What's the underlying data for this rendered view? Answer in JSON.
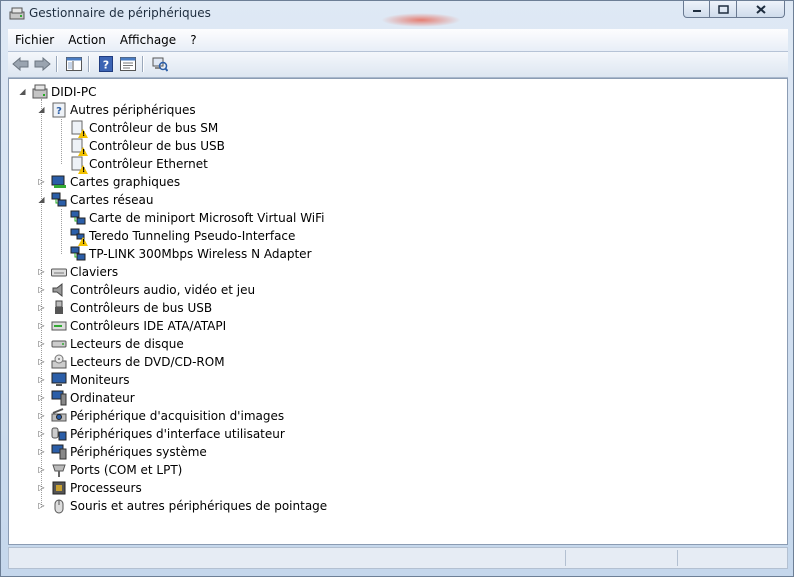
{
  "window": {
    "title": "Gestionnaire de périphériques"
  },
  "menu": [
    "Fichier",
    "Action",
    "Affichage",
    "?"
  ],
  "toolbar": {
    "buttons": [
      "back-icon",
      "forward-icon",
      "show-hide-console-tree-icon",
      "help-icon",
      "properties-icon",
      "scan-hardware-icon"
    ]
  },
  "tree": {
    "root": "DIDI-PC",
    "categories": [
      {
        "label": "Autres périphériques",
        "expanded": true,
        "icon": "unknown-device-icon",
        "children": [
          "Contrôleur de bus SM",
          "Contrôleur de bus USB",
          "Contrôleur Ethernet"
        ]
      },
      {
        "label": "Cartes graphiques",
        "expanded": false,
        "icon": "display-adapter-icon"
      },
      {
        "label": "Cartes réseau",
        "expanded": true,
        "icon": "network-adapter-icon",
        "children": [
          "Carte de miniport Microsoft Virtual WiFi",
          "Teredo Tunneling Pseudo-Interface",
          "TP-LINK 300Mbps Wireless N Adapter"
        ]
      },
      {
        "label": "Claviers",
        "expanded": false,
        "icon": "keyboard-icon"
      },
      {
        "label": "Contrôleurs audio, vidéo et jeu",
        "expanded": false,
        "icon": "speaker-icon"
      },
      {
        "label": "Contrôleurs de bus USB",
        "expanded": false,
        "icon": "usb-icon"
      },
      {
        "label": "Contrôleurs IDE ATA/ATAPI",
        "expanded": false,
        "icon": "ide-controller-icon"
      },
      {
        "label": "Lecteurs de disque",
        "expanded": false,
        "icon": "disk-drive-icon"
      },
      {
        "label": "Lecteurs de DVD/CD-ROM",
        "expanded": false,
        "icon": "dvd-drive-icon"
      },
      {
        "label": "Moniteurs",
        "expanded": false,
        "icon": "monitor-icon"
      },
      {
        "label": "Ordinateur",
        "expanded": false,
        "icon": "computer-icon"
      },
      {
        "label": "Périphérique d'acquisition d'images",
        "expanded": false,
        "icon": "imaging-device-icon"
      },
      {
        "label": "Périphériques d'interface utilisateur",
        "expanded": false,
        "icon": "hid-icon"
      },
      {
        "label": "Périphériques système",
        "expanded": false,
        "icon": "system-device-icon"
      },
      {
        "label": "Ports (COM et LPT)",
        "expanded": false,
        "icon": "port-icon"
      },
      {
        "label": "Processeurs",
        "expanded": false,
        "icon": "processor-icon"
      },
      {
        "label": "Souris et autres périphériques de pointage",
        "expanded": false,
        "icon": "mouse-icon"
      }
    ]
  },
  "colors": {
    "window_frame": "#c5d7ec",
    "warning": "#f2c200",
    "tree_bg": "#ffffff"
  }
}
